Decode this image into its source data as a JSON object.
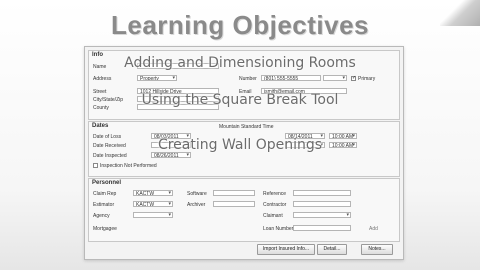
{
  "slide": {
    "title": "Learning Objectives",
    "objectives": [
      "Adding and Dimensioning Rooms",
      "Using the Square Break Tool",
      "Creating Wall Openings"
    ]
  },
  "info": {
    "section_title": "Info",
    "name_label": "Name",
    "address_label": "Address",
    "address_type": "Property",
    "street_label": "Street",
    "street_value": "1012 Hillside Drive",
    "city_label": "City/State/Zip",
    "county_label": "County",
    "number_label": "Number",
    "phone_value": "(801) 555-5555",
    "primary_label": "Primary",
    "email_label": "Email",
    "email_value": "jsmith@email.com"
  },
  "dates": {
    "section_title": "Dates",
    "timezone": "Mountain Standard Time",
    "loss_label": "Date of Loss",
    "loss_value": "08/03/2011",
    "received_label": "Date Received",
    "inspected_label": "Date Inspected",
    "inspected_value": "08/26/2011",
    "notperformed_label": "Inspection Not Performed",
    "right_date": "08/14/2011",
    "right_time": "10:00 AM"
  },
  "personnel": {
    "section_title": "Personnel",
    "claim_rep_label": "Claim Rep",
    "estimator_label": "Estimator",
    "agency_label": "Agency",
    "mortgagee_label": "Mortgagee",
    "claim_rep_value": "KACTW",
    "estimator_value": "KACTW",
    "software_label": "Software",
    "archiver_label": "Archiver",
    "reference_label": "Reference",
    "contractor_label": "Contractor",
    "claimant_label": "Claimant",
    "loan_label": "Loan Number",
    "add_label": "Add"
  },
  "buttons": {
    "import": "Import Insured Info...",
    "detail": "Detail...",
    "notes": "Notes..."
  }
}
